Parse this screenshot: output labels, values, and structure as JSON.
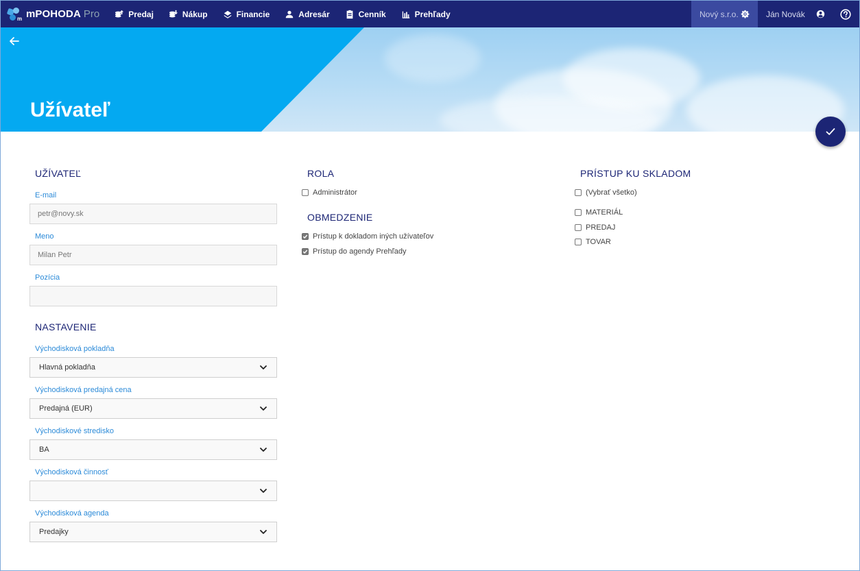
{
  "app": {
    "name": "mPOHODA",
    "edition": "Pro"
  },
  "nav": [
    {
      "label": "Predaj",
      "icon": "coins-up-icon"
    },
    {
      "label": "Nákup",
      "icon": "coins-down-icon"
    },
    {
      "label": "Financie",
      "icon": "finance-icon"
    },
    {
      "label": "Adresár",
      "icon": "person-icon"
    },
    {
      "label": "Cenník",
      "icon": "clipboard-icon"
    },
    {
      "label": "Prehľady",
      "icon": "bar-chart-icon"
    }
  ],
  "company": {
    "name": "Nový s.r.o.",
    "icon": "gear-icon"
  },
  "user": {
    "name": "Ján Novák",
    "icon": "account-icon"
  },
  "page": {
    "title": "Užívateľ"
  },
  "user_section": {
    "heading": "UŽÍVATEĽ",
    "email_label": "E-mail",
    "email_value": "petr@novy.sk",
    "name_label": "Meno",
    "name_value": "Milan Petr",
    "position_label": "Pozícia",
    "position_value": ""
  },
  "settings": {
    "heading": "NASTAVENIE",
    "fields": [
      {
        "label": "Východisková pokladňa",
        "value": "Hlavná pokladňa"
      },
      {
        "label": "Východisková predajná cena",
        "value": "Predajná (EUR)"
      },
      {
        "label": "Východiskové stredisko",
        "value": "BA"
      },
      {
        "label": "Východisková činnosť",
        "value": ""
      },
      {
        "label": "Východisková agenda",
        "value": "Predajky"
      }
    ]
  },
  "role": {
    "heading": "ROLA",
    "options": [
      {
        "label": "Administrátor",
        "checked": false
      }
    ]
  },
  "restriction": {
    "heading": "OBMEDZENIE",
    "options": [
      {
        "label": "Prístup k dokladom iných užívateľov",
        "checked": true
      },
      {
        "label": "Prístup do agendy Prehľady",
        "checked": true
      }
    ]
  },
  "warehouse": {
    "heading": "PRÍSTUP KU SKLADOM",
    "select_all": {
      "label": "(Vybrať všetko)",
      "checked": false
    },
    "options": [
      {
        "label": "MATERIÁL",
        "checked": false
      },
      {
        "label": "PREDAJ",
        "checked": false
      },
      {
        "label": "TOVAR",
        "checked": false
      }
    ]
  },
  "colors": {
    "navbar": "#1c2575",
    "accent": "#2b8ad8",
    "banner_blue": "#04a9f1"
  }
}
